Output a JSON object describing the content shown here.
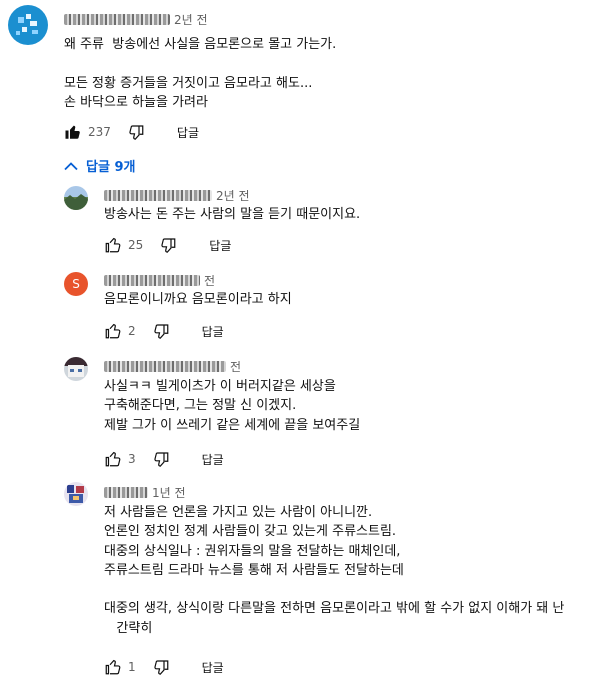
{
  "main_comment": {
    "time": "2년 전",
    "text": "왜 주류  방송에선 사실을 음모론으로 몰고 가는가.\n\n모든 정황 증거들을 거짓이고 음모라고 해도...\n손 바닥으로 하늘을 가려라",
    "likes": "237",
    "reply_label": "답글"
  },
  "replies_toggle": {
    "label": "답글 9개"
  },
  "replies": [
    {
      "time": "2년 전",
      "text": "방송사는 돈 주는 사람의 말을 듣기 때문이지요.",
      "likes": "25",
      "reply_label": "답글"
    },
    {
      "avatar_letter": "S",
      "time": "전",
      "text": "음모론이니까요 음모론이라고 하지",
      "likes": "2",
      "reply_label": "답글"
    },
    {
      "time": "전",
      "text": "사실ㅋㅋ 빌게이츠가 이 버러지같은 세상을\n구축해준다면, 그는 정말 신 이겠지.\n제발 그가 이 쓰레기 같은 세계에 끝을 보여주길",
      "likes": "3",
      "reply_label": "답글"
    },
    {
      "time": "1년 전",
      "text": "저 사람들은 언론을 가지고 있는 사람이 아니니깐.\n언론인 정치인 정계 사람들이 갖고 있는게 주류스트림.\n대중의 상식일나 : 권위자들의 말을 전달하는 매체인데,\n주류스트림 드라마 뉴스를 통해 저 사람들도 전달하는데\n\n대중의 생각, 상식이랑 다른말을 전하면 음모론이라고 밖에 할 수가 없지 이해가 돼 난\n   간략히",
      "likes": "1",
      "reply_label": "답글"
    }
  ],
  "colors": {
    "link_blue": "#065fd4",
    "meta_gray": "#606060",
    "avatar_s": "#e8542c"
  }
}
